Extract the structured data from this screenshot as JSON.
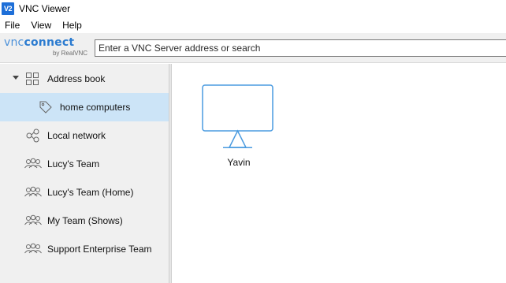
{
  "window": {
    "app_icon_text": "V2",
    "title": "VNC Viewer"
  },
  "menu": [
    "File",
    "View",
    "Help"
  ],
  "toolbar": {
    "logo_vnc": "vnc",
    "logo_connect": "connect",
    "logo_sub": "by RealVNC",
    "search_placeholder": "Enter a VNC Server address or search"
  },
  "sidebar": {
    "items": [
      {
        "label": "Address book",
        "icon": "grid-icon",
        "expanded": true
      },
      {
        "label": "home computers",
        "icon": "tag-icon",
        "selected": true
      },
      {
        "label": "Local network",
        "icon": "network-icon"
      },
      {
        "label": "Lucy's Team",
        "icon": "team-icon"
      },
      {
        "label": "Lucy's Team (Home)",
        "icon": "team-icon"
      },
      {
        "label": "My Team (Shows)",
        "icon": "team-icon"
      },
      {
        "label": "Support Enterprise Team",
        "icon": "team-icon"
      }
    ]
  },
  "main": {
    "computers": [
      {
        "name": "Yavin",
        "icon": "monitor-icon"
      }
    ]
  },
  "colors": {
    "accent": "#1e6fd8",
    "selection": "#cce4f7",
    "sidebar_bg": "#f0f0f0",
    "monitor_stroke": "#4a9be0"
  }
}
